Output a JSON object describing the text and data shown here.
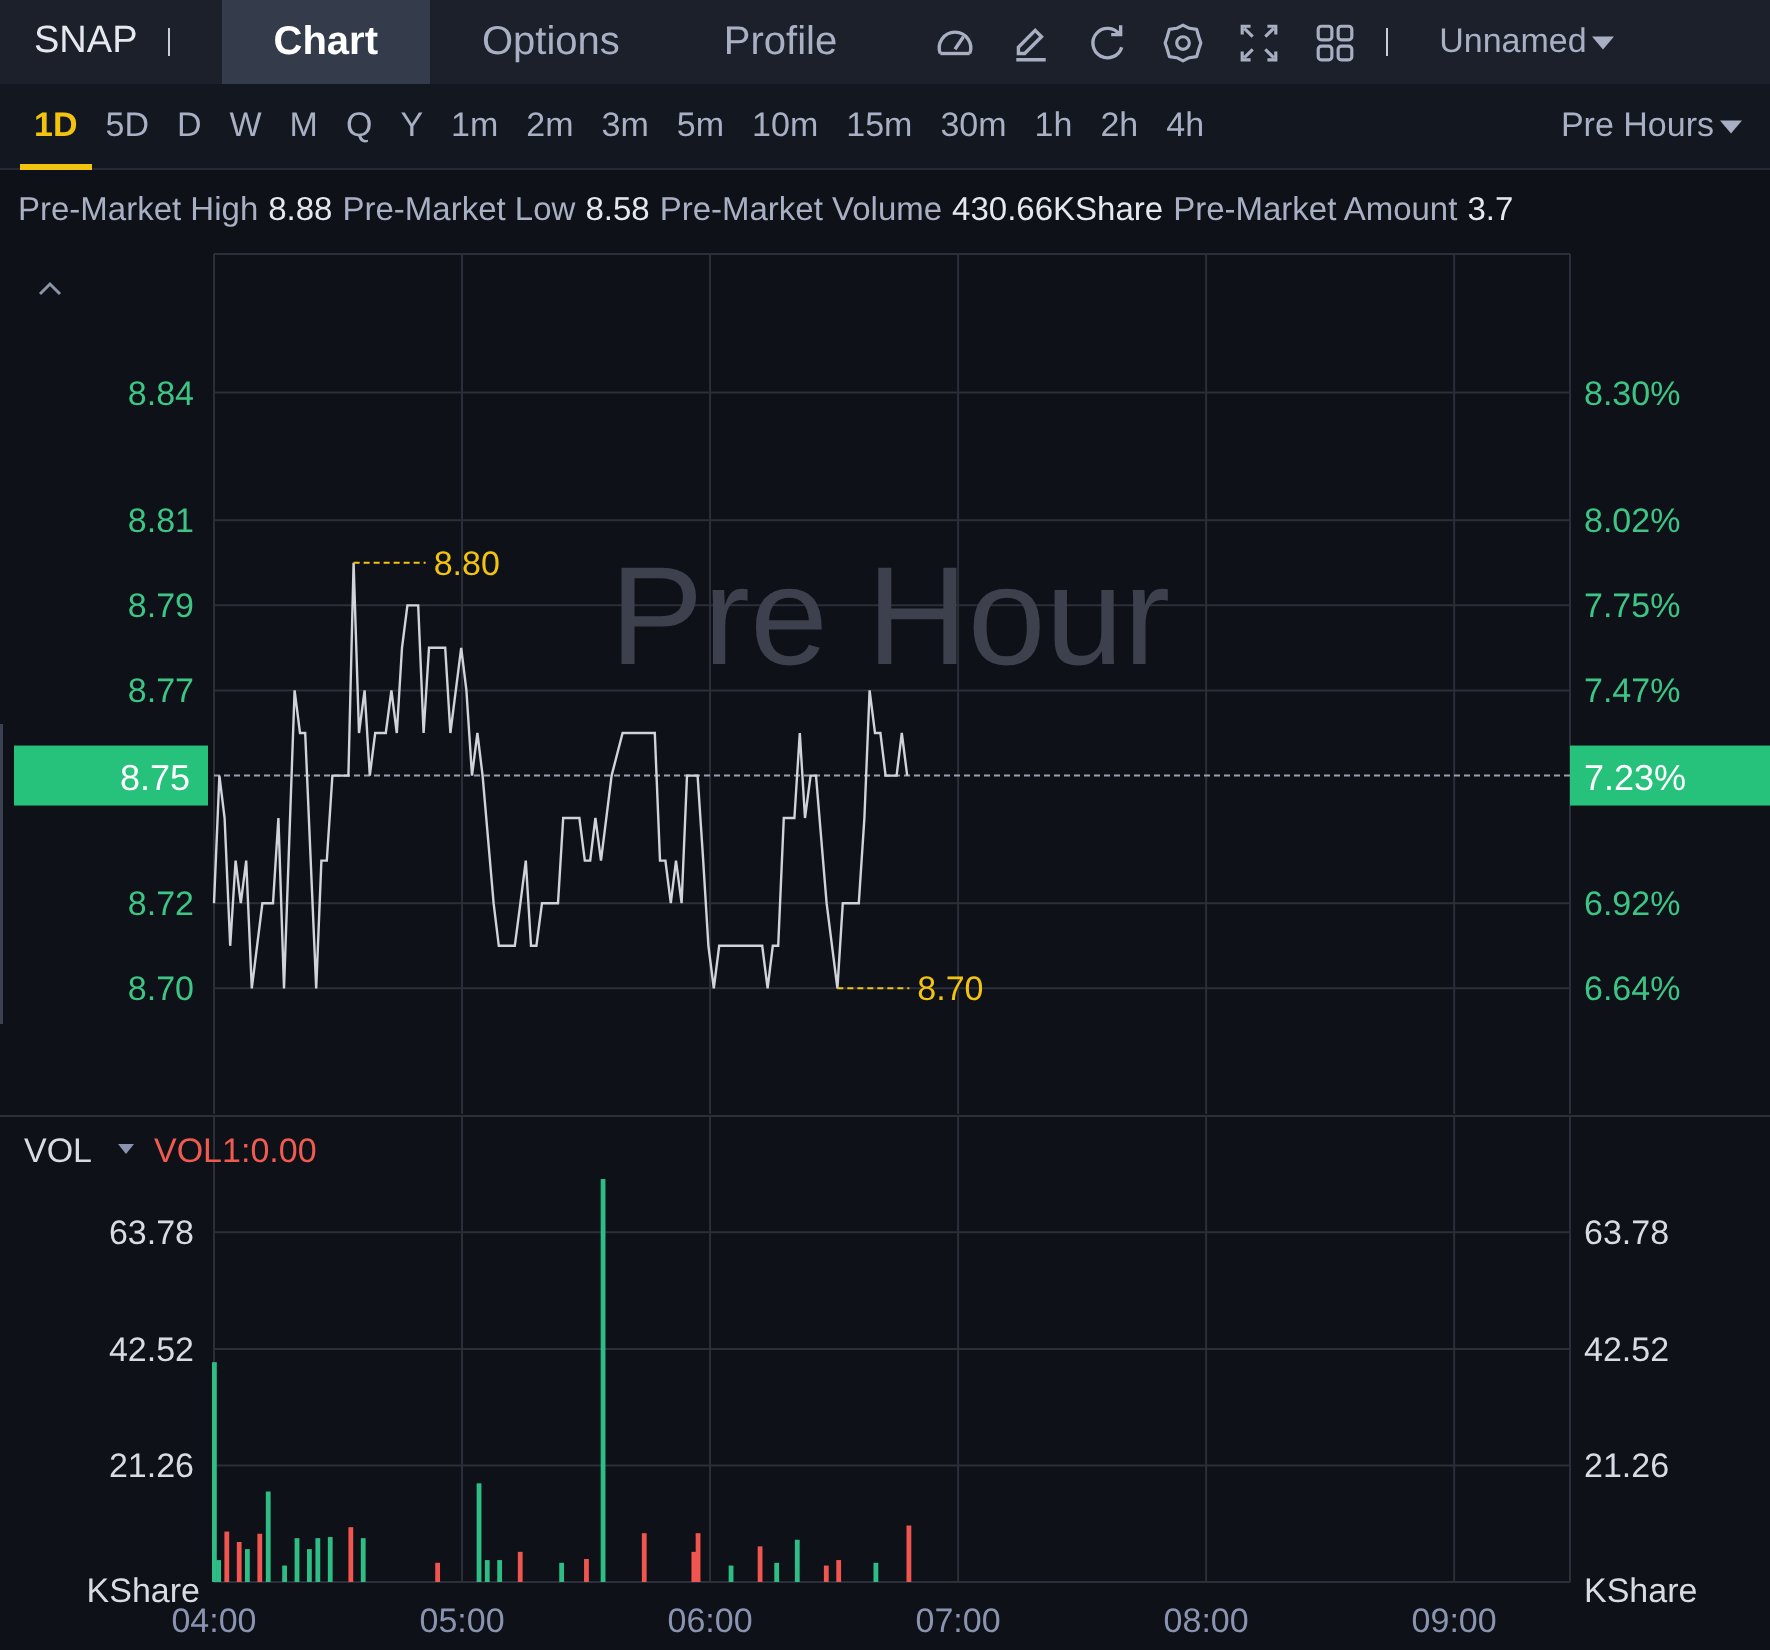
{
  "header": {
    "symbol": "SNAP",
    "tabs": [
      {
        "label": "Chart",
        "selected": true
      },
      {
        "label": "Options",
        "selected": false
      },
      {
        "label": "Profile",
        "selected": false
      }
    ],
    "tools": [
      {
        "kind": "gauge"
      },
      {
        "kind": "pencil"
      },
      {
        "kind": "refresh"
      },
      {
        "kind": "settings"
      },
      {
        "kind": "fullscreen"
      },
      {
        "kind": "grid"
      }
    ],
    "layout_dropdown": "Unnamed"
  },
  "timeframes": [
    {
      "label": "1D",
      "selected": true
    },
    {
      "label": "5D",
      "selected": false
    },
    {
      "label": "D",
      "selected": false
    },
    {
      "label": "W",
      "selected": false
    },
    {
      "label": "M",
      "selected": false
    },
    {
      "label": "Q",
      "selected": false
    },
    {
      "label": "Y",
      "selected": false
    },
    {
      "label": "1m",
      "selected": false
    },
    {
      "label": "2m",
      "selected": false
    },
    {
      "label": "3m",
      "selected": false
    },
    {
      "label": "5m",
      "selected": false
    },
    {
      "label": "10m",
      "selected": false
    },
    {
      "label": "15m",
      "selected": false
    },
    {
      "label": "30m",
      "selected": false
    },
    {
      "label": "1h",
      "selected": false
    },
    {
      "label": "2h",
      "selected": false
    },
    {
      "label": "4h",
      "selected": false
    }
  ],
  "session_dropdown": "Pre Hours",
  "stats": [
    {
      "label": "Pre-Market High",
      "value": "8.88"
    },
    {
      "label": "Pre-Market Low",
      "value": "8.58"
    },
    {
      "label": "Pre-Market Volume",
      "value": "430.66KShare"
    },
    {
      "label": "Pre-Market Amount",
      "value": "3.7"
    }
  ],
  "price_pane": {
    "watermark": "Pre Hour",
    "current_price": "8.75",
    "current_change": "7.23%",
    "right_axis_labels": [
      "8.30%",
      "8.02%",
      "7.75%",
      "7.47%",
      "6.92%",
      "6.64%"
    ],
    "chart_data": {
      "type": "line",
      "xlim": [
        4,
        9.467
      ],
      "ylim": [
        8.6714,
        8.8721
      ],
      "yticks": [
        {
          "value": 8.84,
          "label": "8.84"
        },
        {
          "value": 8.81,
          "label": "8.81"
        },
        {
          "value": 8.79,
          "label": "8.79"
        },
        {
          "value": 8.77,
          "label": "8.77"
        },
        {
          "value": 8.72,
          "label": "8.72"
        },
        {
          "value": 8.7,
          "label": "8.70"
        }
      ],
      "grid": true,
      "ref_lines": [
        {
          "axis": "y",
          "value": 8.75
        }
      ],
      "x": [
        4,
        4.022,
        4.043,
        4.065,
        4.087,
        4.108,
        4.13,
        4.152,
        4.195,
        4.238,
        4.26,
        4.282,
        4.325,
        4.347,
        4.368,
        4.412,
        4.433,
        4.455,
        4.477,
        4.542,
        4.563,
        4.585,
        4.607,
        4.628,
        4.65,
        4.693,
        4.715,
        4.737,
        4.758,
        4.78,
        4.823,
        4.845,
        4.867,
        4.932,
        4.953,
        4.975,
        4.997,
        5.018,
        5.04,
        5.062,
        5.083,
        5.127,
        5.148,
        5.213,
        5.235,
        5.257,
        5.278,
        5.3,
        5.322,
        5.387,
        5.408,
        5.473,
        5.495,
        5.517,
        5.538,
        5.56,
        5.603,
        5.647,
        5.777,
        5.798,
        5.82,
        5.842,
        5.863,
        5.885,
        5.907,
        5.95,
        5.972,
        5.993,
        6.015,
        6.037,
        6.21,
        6.232,
        6.253,
        6.275,
        6.297,
        6.34,
        6.362,
        6.383,
        6.405,
        6.427,
        6.47,
        6.513,
        6.535,
        6.6,
        6.622,
        6.643,
        6.665,
        6.687,
        6.708,
        6.752,
        6.773,
        6.795
      ],
      "series": [
        {
          "color": "#d0d3da",
          "values": [
            8.72,
            8.75,
            8.74,
            8.71,
            8.73,
            8.72,
            8.73,
            8.7,
            8.72,
            8.72,
            8.74,
            8.7,
            8.77,
            8.76,
            8.76,
            8.7,
            8.73,
            8.73,
            8.75,
            8.75,
            8.8,
            8.76,
            8.77,
            8.75,
            8.76,
            8.76,
            8.77,
            8.76,
            8.78,
            8.79,
            8.79,
            8.76,
            8.78,
            8.78,
            8.76,
            8.77,
            8.78,
            8.77,
            8.75,
            8.76,
            8.75,
            8.72,
            8.71,
            8.71,
            8.72,
            8.73,
            8.71,
            8.71,
            8.72,
            8.72,
            8.74,
            8.74,
            8.73,
            8.73,
            8.74,
            8.73,
            8.75,
            8.76,
            8.76,
            8.73,
            8.73,
            8.72,
            8.73,
            8.72,
            8.75,
            8.75,
            8.73,
            8.71,
            8.7,
            8.71,
            8.71,
            8.7,
            8.71,
            8.71,
            8.74,
            8.74,
            8.76,
            8.74,
            8.75,
            8.75,
            8.72,
            8.7,
            8.72,
            8.72,
            8.74,
            8.77,
            8.76,
            8.76,
            8.75,
            8.75,
            8.76,
            8.75
          ]
        }
      ],
      "annotations": [
        {
          "x": 4.563,
          "y": 8.8,
          "text": "8.80"
        },
        {
          "x": 6.513,
          "y": 8.7,
          "text": "8.70"
        }
      ]
    }
  },
  "volume_pane": {
    "indicator": "VOL",
    "indicator_value": "VOL1:0.00",
    "unit_left": "KShare",
    "unit_right": "KShare",
    "right_axis_labels": [
      "63.78",
      "42.52",
      "21.26"
    ],
    "chart_data": {
      "type": "bar",
      "xlim": [
        4,
        9.467
      ],
      "ylim": [
        0,
        85
      ],
      "stacked": true,
      "grid": true,
      "xticks": [
        {
          "value": 4,
          "label": "04:00"
        },
        {
          "value": 5,
          "label": "05:00"
        },
        {
          "value": 6,
          "label": "06:00"
        },
        {
          "value": 7,
          "label": "07:00"
        },
        {
          "value": 8,
          "label": "08:00"
        },
        {
          "value": 9,
          "label": "09:00"
        }
      ],
      "yticks": [
        {
          "value": 63.78,
          "label": "63.78"
        },
        {
          "value": 42.52,
          "label": "42.52"
        },
        {
          "value": 21.26,
          "label": "21.26"
        }
      ],
      "x": [
        4,
        4.017,
        4.05,
        4.1,
        4.133,
        4.183,
        4.217,
        4.283,
        4.333,
        4.383,
        4.417,
        4.467,
        4.55,
        4.6,
        4.9,
        5.067,
        5.1,
        5.15,
        5.233,
        5.4,
        5.5,
        5.567,
        5.733,
        5.933,
        5.95,
        6.083,
        6.2,
        6.267,
        6.35,
        6.467,
        6.517,
        6.667,
        6.8
      ],
      "series": [
        {
          "color": "#2ebd85",
          "values": [
            40.1,
            4,
            null,
            null,
            6,
            null,
            16.5,
            3,
            8,
            6,
            8,
            8.2,
            null,
            8,
            null,
            18,
            4,
            4,
            null,
            3.5,
            null,
            73.5,
            null,
            null,
            null,
            3,
            null,
            3.5,
            7.7,
            null,
            null,
            3.5,
            null
          ]
        },
        {
          "color": "#f0554f",
          "values": [
            null,
            null,
            9.2,
            7.3,
            null,
            8.8,
            null,
            null,
            null,
            null,
            null,
            null,
            10,
            null,
            3.5,
            null,
            null,
            null,
            5.5,
            null,
            4.2,
            null,
            8.9,
            5.5,
            8.9,
            null,
            6.5,
            null,
            null,
            3,
            4,
            null,
            10.3
          ]
        }
      ]
    }
  }
}
